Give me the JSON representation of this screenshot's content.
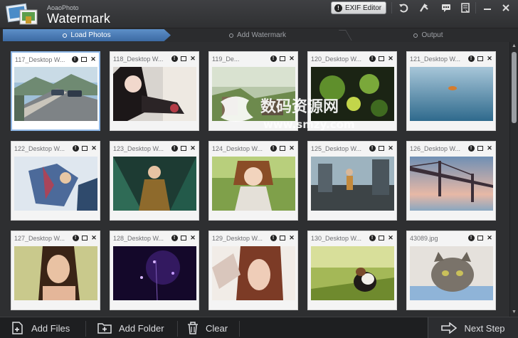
{
  "app": {
    "subtitle": "AoaoPhoto",
    "title": "Watermark",
    "exif_label": "EXIF Editor"
  },
  "steps": [
    {
      "label": "Load Photos",
      "active": true
    },
    {
      "label": "Add Watermark",
      "active": false
    },
    {
      "label": "Output",
      "active": false
    }
  ],
  "photos": [
    {
      "name": "117_Desktop W...",
      "selected": true
    },
    {
      "name": "118_Desktop W..."
    },
    {
      "name": "119_De..."
    },
    {
      "name": "120_Desktop W..."
    },
    {
      "name": "121_Desktop W..."
    },
    {
      "name": "122_Desktop W..."
    },
    {
      "name": "123_Desktop W..."
    },
    {
      "name": "124_Desktop W..."
    },
    {
      "name": "125_Desktop W..."
    },
    {
      "name": "126_Desktop W..."
    },
    {
      "name": "127_Desktop W..."
    },
    {
      "name": "128_Desktop W..."
    },
    {
      "name": "129_Desktop W..."
    },
    {
      "name": "130_Desktop W..."
    },
    {
      "name": "43089.jpg"
    }
  ],
  "overlay": {
    "site_text": "数码资源网",
    "site_url": "www.smzy.com"
  },
  "bottom": {
    "add_files": "Add Files",
    "add_folder": "Add Folder",
    "clear": "Clear",
    "next_step": "Next Step"
  }
}
